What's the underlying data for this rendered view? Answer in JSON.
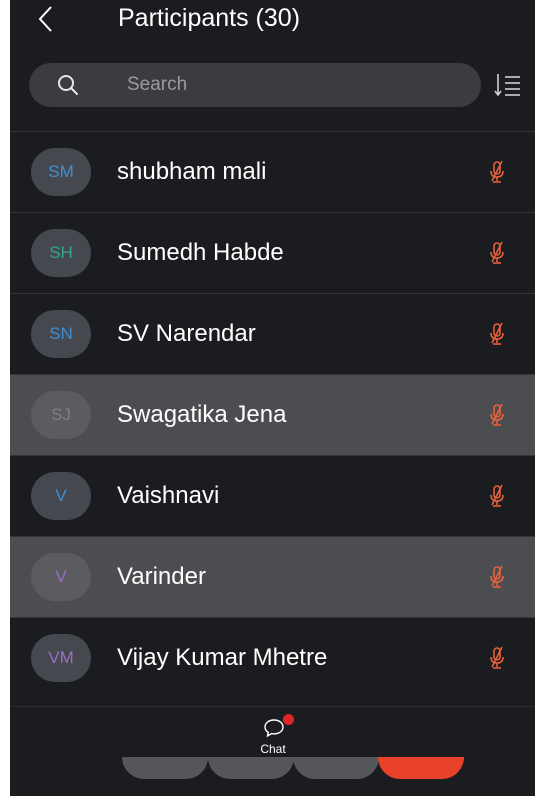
{
  "header": {
    "title": "Participants (30)",
    "back_icon": "chevron-left-icon"
  },
  "search": {
    "placeholder": "Search",
    "icon": "search-icon"
  },
  "sort": {
    "icon": "sort-icon"
  },
  "participants": [
    {
      "initials": "SM",
      "name": "shubham mali",
      "color": "#3f8fd0",
      "highlighted": false,
      "mic": "muted"
    },
    {
      "initials": "SH",
      "name": "Sumedh Habde",
      "color": "#31a886",
      "highlighted": false,
      "mic": "muted"
    },
    {
      "initials": "SN",
      "name": "SV Narendar",
      "color": "#3f8fd0",
      "highlighted": false,
      "mic": "muted"
    },
    {
      "initials": "SJ",
      "name": "Swagatika Jena",
      "color": "#7d7f84",
      "highlighted": true,
      "mic": "muted"
    },
    {
      "initials": "V",
      "name": "Vaishnavi",
      "color": "#3f8fd0",
      "highlighted": false,
      "mic": "muted"
    },
    {
      "initials": "V",
      "name": "Varinder",
      "color": "#9b6dc6",
      "highlighted": true,
      "mic": "muted"
    },
    {
      "initials": "VM",
      "name": "Vijay Kumar Mhetre",
      "color": "#9b6dc6",
      "highlighted": false,
      "mic": "muted"
    }
  ],
  "bottom_bar": {
    "chat_label": "Chat",
    "chat_has_unread": true,
    "controls": [
      {
        "name": "control-button-1",
        "color": "#55565a"
      },
      {
        "name": "control-button-2",
        "color": "#55565a"
      },
      {
        "name": "control-button-3",
        "color": "#55565a"
      },
      {
        "name": "leave-button",
        "color": "#e8432a"
      }
    ]
  },
  "colors": {
    "background": "#1b1c1f",
    "muted_mic": "#e8603c",
    "unread_dot": "#e02626"
  }
}
